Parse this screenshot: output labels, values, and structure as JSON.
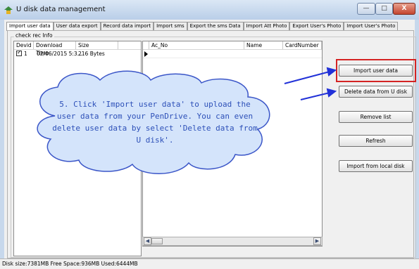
{
  "window": {
    "title": "U disk data management",
    "minimize": "—",
    "maximize": "□",
    "close": "X"
  },
  "tabs": [
    "Import user data",
    "User data export",
    "Record data import",
    "Import sms",
    "Export the sms Data",
    "Import Att Photo",
    "Export User's Photo",
    "Import User's Photo"
  ],
  "group": {
    "label": "check rec Info"
  },
  "left_list": {
    "columns": [
      "Devid",
      "Download Time",
      "Size"
    ],
    "rows": [
      {
        "devid": "1",
        "download_time": "02/06/2015 5:3...",
        "size": "216 Bytes",
        "checked": true
      }
    ]
  },
  "right_list": {
    "columns": [
      "Ac_No",
      "Name",
      "CardNumber"
    ]
  },
  "buttons": {
    "import_user_data": "Import user data",
    "delete_from_u_disk": "Delete data from U disk",
    "remove_list": "Remove list",
    "refresh": "Refresh",
    "import_from_local_disk": "Import from local disk"
  },
  "callout": {
    "text": "5. Click 'Import user data' to upload the user data from your PenDrive. You can even delete user data by select 'Delete data from U disk'."
  },
  "status": {
    "text": "Disk size:7381MB  Free Space:936MB  Used:6444MB"
  },
  "colors": {
    "callout_fill": "#d4e4fb",
    "callout_border": "#3b56c8",
    "callout_text": "#2d50b8",
    "arrow": "#2131d8",
    "highlight": "#d42323"
  }
}
